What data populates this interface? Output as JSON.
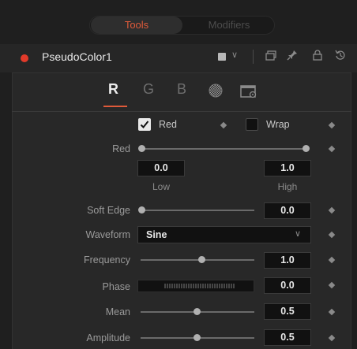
{
  "tabs": {
    "tools": "Tools",
    "modifiers": "Modifiers"
  },
  "header": {
    "tool_name": "PseudoColor1",
    "icons": [
      "color-swatch-icon",
      "chevron-down-icon",
      "versions-icon",
      "pin-icon",
      "lock-icon",
      "reset-icon"
    ]
  },
  "channel_tabs": [
    "R",
    "G",
    "B"
  ],
  "channel_icons": [
    "common-controls-icon",
    "settings-icon"
  ],
  "accent_color": "#e05a3a",
  "controls": {
    "red_checkbox": {
      "label": "Red",
      "checked": true
    },
    "wrap_checkbox": {
      "label": "Wrap",
      "checked": false
    },
    "red_range": {
      "label": "Red",
      "low": "0.0",
      "high": "1.0",
      "low_label": "Low",
      "high_label": "High"
    },
    "soft_edge": {
      "label": "Soft Edge",
      "value": "0.0"
    },
    "waveform": {
      "label": "Waveform",
      "value": "Sine"
    },
    "frequency": {
      "label": "Frequency",
      "value": "1.0"
    },
    "phase": {
      "label": "Phase",
      "value": "0.0"
    },
    "mean": {
      "label": "Mean",
      "value": "0.5"
    },
    "amplitude": {
      "label": "Amplitude",
      "value": "0.5"
    }
  }
}
